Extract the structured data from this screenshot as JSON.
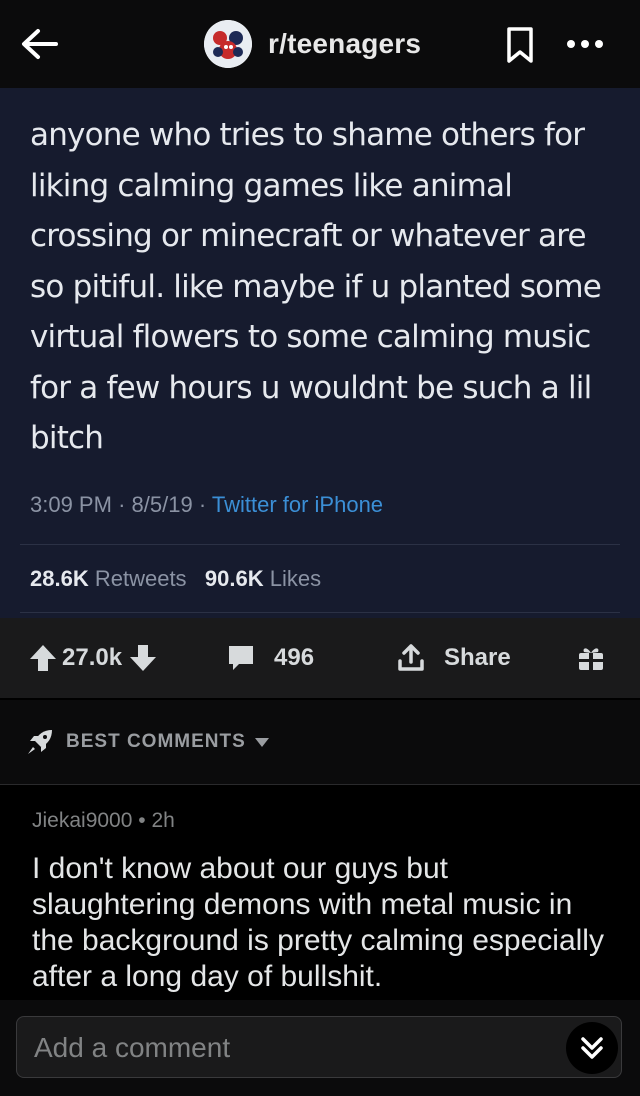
{
  "header": {
    "subreddit": "r/teenagers"
  },
  "tweet": {
    "text": "anyone who tries to shame others for liking calming games like animal crossing or minecraft or whatever are so pitiful. like maybe if u planted some virtual flowers to some calming music for a few hours u wouldnt be such a lil bitch",
    "time": "3:09 PM",
    "date": "8/5/19",
    "source": "Twitter for iPhone",
    "retweets_count": "28.6K",
    "retweets_label": "Retweets",
    "likes_count": "90.6K",
    "likes_label": "Likes"
  },
  "actions": {
    "score": "27.0k",
    "comments": "496",
    "share_label": "Share"
  },
  "sort": {
    "label": "BEST COMMENTS"
  },
  "comment": {
    "author": "Jiekai9000",
    "age": "2h",
    "body": "I don't know about our guys but slaughtering demons with metal music in the background is pretty calming especially after a long day of bullshit."
  },
  "composer": {
    "placeholder": "Add a comment"
  },
  "colors": {
    "tweet_bg": "#161b2e",
    "link_blue": "#3b8fd6",
    "bar_bg": "#1a1a1b"
  }
}
